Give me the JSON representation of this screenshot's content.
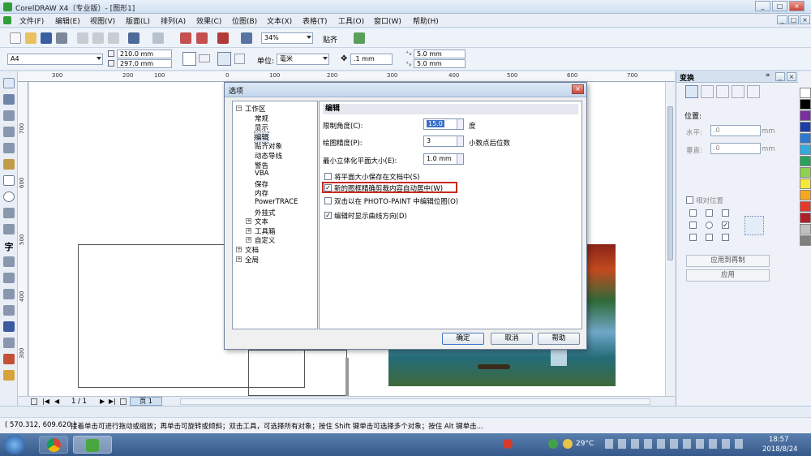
{
  "app": {
    "title": "CorelDRAW X4（专业版）- [图形1]",
    "title_controls": [
      "_",
      "□",
      "×"
    ]
  },
  "menu": [
    "文件(F)",
    "编辑(E)",
    "视图(V)",
    "版面(L)",
    "排列(A)",
    "效果(C)",
    "位图(B)",
    "文本(X)",
    "表格(T)",
    "工具(O)",
    "窗口(W)",
    "帮助(H)"
  ],
  "toolbar": {
    "zoom": "34%",
    "snap_label": "贴齐"
  },
  "property_bar": {
    "paper": "A4",
    "width": "210.0 mm",
    "height": "297.0 mm",
    "unit_label": "单位:",
    "unit": "毫米",
    "nudge": ".1 mm",
    "dup_x": "5.0 mm",
    "dup_y": "5.0 mm"
  },
  "rulers": {
    "h": [
      "300",
      "200",
      "100",
      "0",
      "100",
      "200",
      "300",
      "400",
      "500",
      "600",
      "700"
    ],
    "v": [
      "700",
      "600",
      "500",
      "400",
      "300"
    ]
  },
  "page_nav": {
    "counter": "1 / 1",
    "tab": "页 1"
  },
  "status": {
    "coords": "( 570.312, 609.620 )",
    "hint": "接着单击可进行拖动或缩放；再单击可旋转或倾斜；双击工具，可选择所有对象；按住 Shift 键单击可选择多个对象；按住 Alt 键单击..."
  },
  "dialog": {
    "title": "选项",
    "tree": [
      {
        "label": "工作区",
        "level": 0,
        "exp": "−"
      },
      {
        "label": "常规",
        "level": 1
      },
      {
        "label": "显示",
        "level": 1
      },
      {
        "label": "编辑",
        "level": 1
      },
      {
        "label": "贴齐对象",
        "level": 1
      },
      {
        "label": "动态导线",
        "level": 1
      },
      {
        "label": "警告",
        "level": 1
      },
      {
        "label": "VBA",
        "level": 1
      },
      {
        "label": "保存",
        "level": 1
      },
      {
        "label": "内存",
        "level": 1
      },
      {
        "label": "PowerTRACE",
        "level": 1
      },
      {
        "label": "外挂式",
        "level": 1
      },
      {
        "label": "文本",
        "level": 1,
        "exp": "+"
      },
      {
        "label": "工具箱",
        "level": 1,
        "exp": "+"
      },
      {
        "label": "自定义",
        "level": 1,
        "exp": "+"
      },
      {
        "label": "文档",
        "level": 0,
        "exp": "+"
      },
      {
        "label": "全局",
        "level": 0,
        "exp": "+"
      }
    ],
    "section": "编辑",
    "constrain_label": "限制角度(C):",
    "constrain_value": "15.0",
    "constrain_unit": "度",
    "precision_label": "绘图精度(P):",
    "precision_value": "3",
    "precision_unit": "小数点后位数",
    "extrude_label": "最小立体化平面大小(E):",
    "extrude_value": "1.0 mm",
    "cb1": "将平面大小保存在文档中(S)",
    "cb2": "新的图框精确剪裁内容自动居中(W)",
    "cb3": "双击以在 PHOTO-PAINT 中编辑位图(O)",
    "cb4": "编辑时显示曲线方向(D)",
    "ok": "确定",
    "cancel": "取消",
    "help": "帮助"
  },
  "docker": {
    "title": "变换",
    "position": "位置:",
    "h_label": "水平:",
    "h_value": ".0",
    "v_label": "垂直:",
    "v_value": ".0",
    "unit": "mm",
    "relative": "相对位置",
    "apply_dup": "应用到再制",
    "apply": "应用"
  },
  "taskbar": {
    "temp": "29°C",
    "time": "18:57",
    "date": "2018/8/24"
  },
  "colors": {
    "palette": [
      "#ffffff",
      "#000000",
      "#7a2fa0",
      "#1e3ea8",
      "#2d79d0",
      "#33a9e0",
      "#28a35a",
      "#8fd14f",
      "#f5e83a",
      "#f7a622",
      "#e5392c",
      "#b01f2a",
      "#c0c0c0",
      "#808080"
    ]
  }
}
